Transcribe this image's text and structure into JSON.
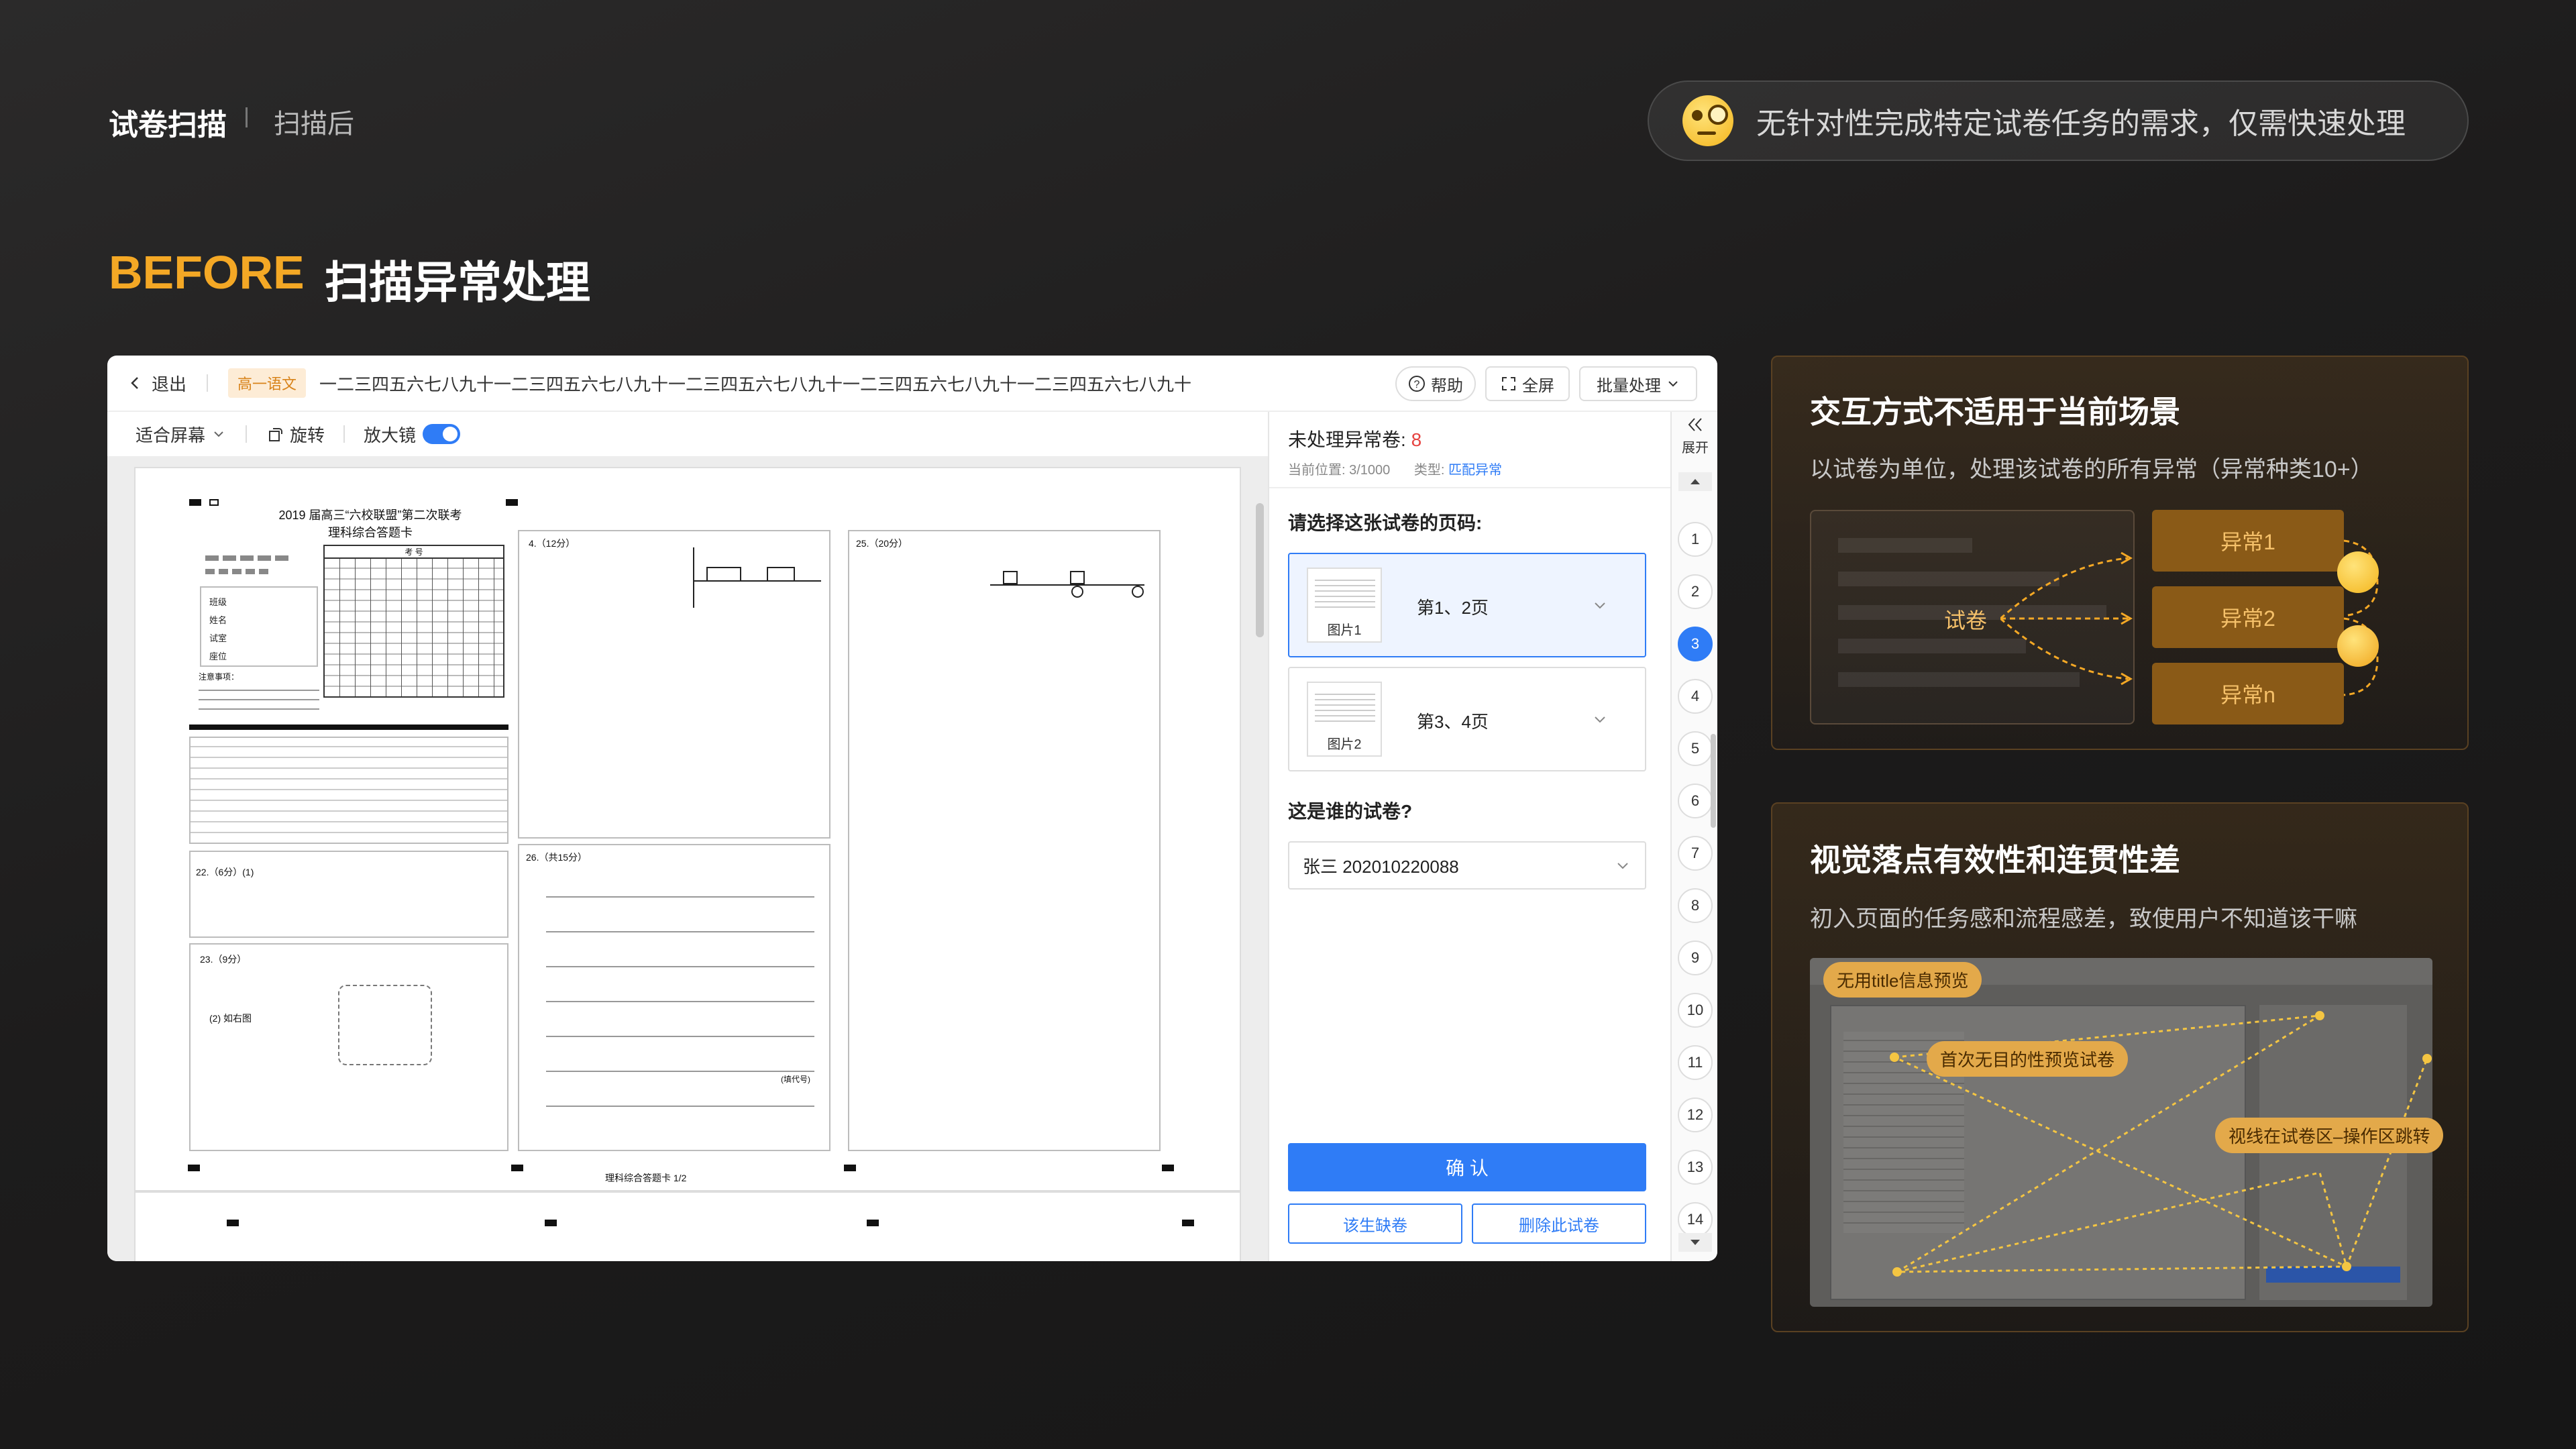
{
  "header": {
    "title": "试卷扫描",
    "subtitle": "扫描后"
  },
  "notice": {
    "text": "无针对性完成特定试卷任务的需求，仅需快速处理",
    "icon": "monocle-face-icon"
  },
  "section": {
    "label": "BEFORE",
    "title": "扫描异常处理"
  },
  "app": {
    "back_label": "退出",
    "subject_badge": "高一语文",
    "exam_title": "一二三四五六七八九十一二三四五六七八九十一二三四五六七八九十一二三四五六七八九十一二三四五六七八九十",
    "help_label": "帮助",
    "fullscreen_label": "全屏",
    "batch_label": "批量处理",
    "fit_label": "适合屏幕",
    "rotate_label": "旋转",
    "magnifier_label": "放大镜",
    "magnifier_on": true,
    "collapse_label": "展开",
    "pending_label": "未处理异常卷:",
    "pending_count": "8",
    "position_label": "当前位置:",
    "position_value": "3/1000",
    "type_label": "类型:",
    "type_value": "匹配异常",
    "page_question": "请选择这张试卷的页码:",
    "images": [
      {
        "thumb_label": "图片1",
        "value": "第1、2页",
        "selected": true
      },
      {
        "thumb_label": "图片2",
        "value": "第3、4页",
        "selected": false
      }
    ],
    "owner_question": "这是谁的试卷?",
    "owner_value": "张三   202010220088",
    "confirm_label": "确 认",
    "absent_label": "该生缺卷",
    "delete_label": "删除此试卷",
    "page_numbers": [
      "1",
      "2",
      "3",
      "4",
      "5",
      "6",
      "7",
      "8",
      "9",
      "10",
      "11",
      "12",
      "13",
      "14"
    ],
    "active_page": "3",
    "sheet": {
      "title1": "2019 届高三“六校联盟”第二次联考",
      "title2": "理科综合答题卡",
      "zkh": "考    号",
      "fields": [
        "班级",
        "姓名",
        "试室",
        "座位"
      ],
      "notes_title": "注意事项：",
      "q4": "4.（12分）",
      "q25": "25.（20分）",
      "q22": "22.（6分）(1)",
      "q23": "23.（9分）",
      "q26": "26.（共15分）",
      "q23_2": "(2) 如右图",
      "fill_note": "(填代号)",
      "footer": "理科综合答题卡 1/2"
    }
  },
  "card1": {
    "title": "交互方式不适用于当前场景",
    "text": "以试卷为单位，处理该试卷的所有异常（异常种类10+）",
    "center": "试卷",
    "items": [
      "异常1",
      "异常2",
      "异常n"
    ]
  },
  "card2": {
    "title": "视觉落点有效性和连贯性差",
    "text": "初入页面的任务感和流程感差，致使用户不知道该干嘛",
    "tags": [
      "无用title信息预览",
      "首次无目的性预览试卷",
      "视线在试卷区–操作区跳转"
    ]
  },
  "colors": {
    "accent": "#f4a825",
    "primary": "#2f7cf6",
    "danger": "#e64340"
  }
}
